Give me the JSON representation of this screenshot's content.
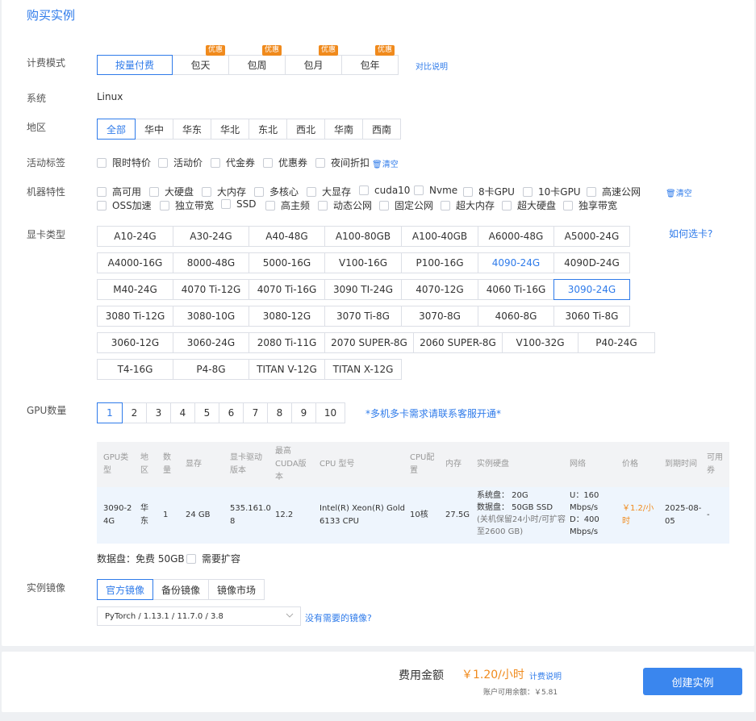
{
  "header": {
    "tab_title": "购买实例"
  },
  "billing": {
    "label": "计费模式",
    "options": [
      "按量付费",
      "包天",
      "包周",
      "包月",
      "包年"
    ],
    "badge": "优惠",
    "compare_link": "对比说明"
  },
  "system": {
    "label": "系统",
    "value": "Linux"
  },
  "region": {
    "label": "地区",
    "options": [
      "全部",
      "华中",
      "华东",
      "华北",
      "东北",
      "西北",
      "华南",
      "西南"
    ]
  },
  "activity": {
    "label": "活动标签",
    "options": [
      "限时特价",
      "活动价",
      "代金券",
      "优惠券",
      "夜间折扣"
    ],
    "clear": "清空"
  },
  "features": {
    "label": "机器特性",
    "row1": [
      "高可用",
      "大硬盘",
      "大内存",
      "多核心",
      "大显存",
      "cuda10",
      "Nvme",
      "8卡GPU",
      "10卡GPU",
      "高速公网"
    ],
    "row2": [
      "OSS加速",
      "独立带宽",
      "SSD",
      "高主频",
      "动态公网",
      "固定公网",
      "超大内存",
      "超大硬盘",
      "独享带宽"
    ],
    "clear": "清空"
  },
  "gpu_type": {
    "label": "显卡类型",
    "help_link": "如何选卡?",
    "rows": [
      [
        "A10-24G",
        "A30-24G",
        "A40-48G",
        "A100-80GB",
        "A100-40GB",
        "A6000-48G",
        "A5000-24G"
      ],
      [
        "A4000-16G",
        "8000-48G",
        "5000-16G",
        "V100-16G",
        "P100-16G",
        "4090-24G",
        "4090D-24G"
      ],
      [
        "M40-24G",
        "4070 Ti-12G",
        "4070 Ti-16G",
        "3090 TI-24G",
        "4070-12G",
        "4060 Ti-16G",
        "3090-24G"
      ],
      [
        "3080 Ti-12G",
        "3080-10G",
        "3080-12G",
        "3070 Ti-8G",
        "3070-8G",
        "4060-8G",
        "3060 Ti-8G"
      ],
      [
        "3060-12G",
        "3060-24G",
        "2080 Ti-11G",
        "2070 SUPER-8G",
        "2060 SUPER-8G",
        "V100-32G",
        "P40-24G"
      ],
      [
        "T4-16G",
        "P4-8G",
        "TITAN V-12G",
        "TITAN X-12G"
      ]
    ]
  },
  "gpu_count": {
    "label": "GPU数量",
    "options": [
      "1",
      "2",
      "3",
      "4",
      "5",
      "6",
      "7",
      "8",
      "9",
      "10"
    ],
    "note": "*多机多卡需求请联系客服开通*"
  },
  "table": {
    "headers": {
      "gpu": [
        "GPU类",
        "型"
      ],
      "region": [
        "地",
        "区"
      ],
      "count": [
        "数",
        "量"
      ],
      "vram": "显存",
      "driver": [
        "显卡驱动",
        "版本"
      ],
      "cuda": [
        "最高",
        "CUDA版",
        "本"
      ],
      "cpu": "CPU 型号",
      "cpu_cfg": [
        "CPU配",
        "置"
      ],
      "mem": "内存",
      "disk": "实例硬盘",
      "net": "网络",
      "price": "价格",
      "expire": "到期时间",
      "coupon": [
        "可用",
        "券"
      ]
    },
    "row": {
      "gpu": [
        "3090-2",
        "4G"
      ],
      "region": [
        "华",
        "东"
      ],
      "count": "1",
      "vram": "24 GB",
      "driver": [
        "535.161.0",
        "8"
      ],
      "cuda": "12.2",
      "cpu": [
        "Intel(R) Xeon(R) Gold",
        "6133 CPU"
      ],
      "cpu_cfg": "10核",
      "mem": "27.5G",
      "disk": [
        "系统盘：  20G",
        "数据盘：  50GB SSD",
        "(关机保留24小时/可扩容",
        "至2600 GB)"
      ],
      "net": [
        "U：160",
        "Mbps/s",
        "D：400",
        "Mbps/s"
      ],
      "price": [
        "￥1.2/小",
        "时"
      ],
      "expire": [
        "2025-08-",
        "05"
      ],
      "coupon": "-"
    }
  },
  "data_disk": {
    "text": "数据盘：免费 50GB",
    "expand": "需要扩容"
  },
  "image": {
    "label": "实例镜像",
    "tabs": [
      "官方镜像",
      "备份镜像",
      "镜像市场"
    ],
    "selected": "PyTorch / 1.13.1 / 11.7.0 / 3.8",
    "missing_link": "没有需要的镜像?"
  },
  "footer": {
    "fee_label": "费用金额",
    "fee_value": "￥1.20/小时",
    "fee_link": "计费说明",
    "balance": "账户可用余额：￥5.81",
    "create_button": "创建实例"
  },
  "colors": {
    "accent": "#2f7bea",
    "price": "#f08a1c",
    "button": "#3a86ee"
  }
}
